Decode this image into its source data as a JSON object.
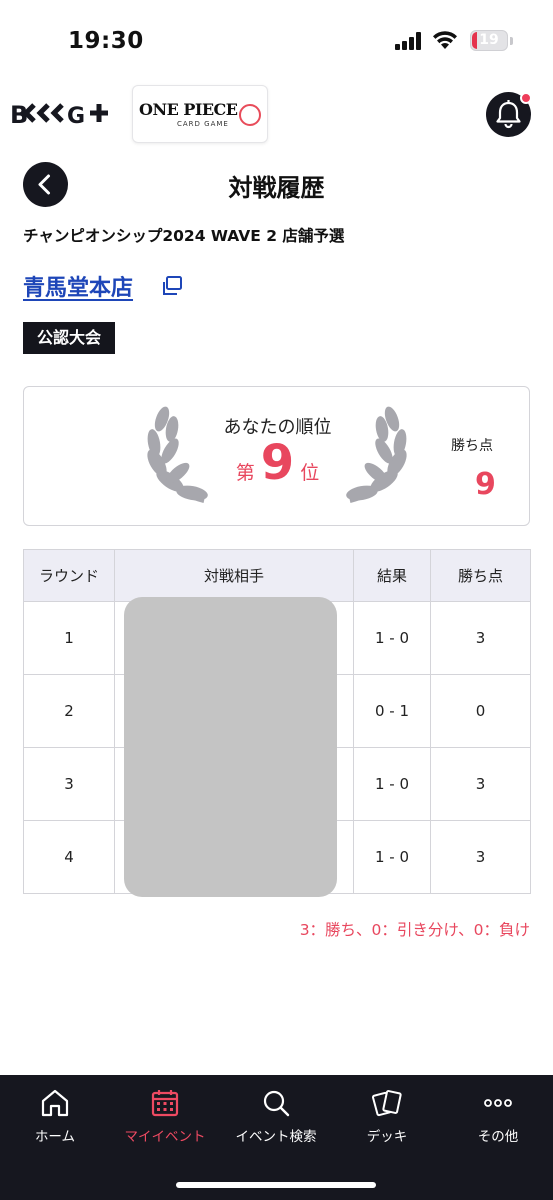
{
  "status_bar": {
    "time": "19:30",
    "battery": "19"
  },
  "header": {
    "bandai_logo_alt": "B-CCG+",
    "op_logo_title": "ONE PIECE",
    "op_logo_sub": "CARD GAME"
  },
  "page": {
    "title": "対戦履歴",
    "event_name": "チャンピオンシップ2024 WAVE 2 店舗予選",
    "store_name": "青馬堂本店",
    "badge": "公認大会"
  },
  "rank_card": {
    "label": "あなたの順位",
    "prefix": "第",
    "rank": "9",
    "suffix": "位",
    "points_label": "勝ち点",
    "points": "9"
  },
  "table": {
    "headers": [
      "ラウンド",
      "対戦相手",
      "結果",
      "勝ち点"
    ],
    "rows": [
      {
        "round": "1",
        "opponent": "",
        "result": "1 - 0",
        "points": "3"
      },
      {
        "round": "2",
        "opponent": "",
        "result": "0 - 1",
        "points": "0"
      },
      {
        "round": "3",
        "opponent": "",
        "result": "1 - 0",
        "points": "3"
      },
      {
        "round": "4",
        "opponent": "",
        "result": "1 - 0",
        "points": "3"
      }
    ]
  },
  "legend": "3：勝ち、0：引き分け、0：負け",
  "nav": {
    "items": [
      {
        "label": "ホーム",
        "icon": "home-icon"
      },
      {
        "label": "マイイベント",
        "icon": "calendar-icon"
      },
      {
        "label": "イベント検索",
        "icon": "search-icon"
      },
      {
        "label": "デッキ",
        "icon": "cards-icon"
      },
      {
        "label": "その他",
        "icon": "more-icon"
      }
    ],
    "active_index": 1
  },
  "colors": {
    "accent": "#e8475e",
    "link": "#1e46b8",
    "dark": "#16171f"
  }
}
